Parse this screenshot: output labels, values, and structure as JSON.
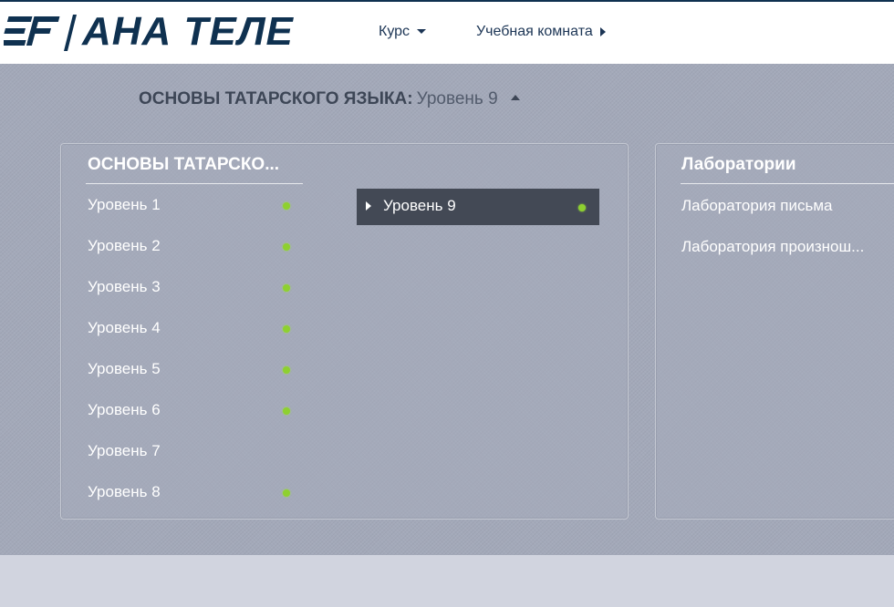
{
  "header": {
    "logo_text": "АНА ТЕЛЕ",
    "nav": {
      "course": "Курс",
      "classroom": "Учебная комната"
    }
  },
  "breadcrumb": {
    "course": "ОСНОВЫ ТАТАРСКОГО ЯЗЫКА:",
    "level": "Уровень 9"
  },
  "course_panel": {
    "title": "ОСНОВЫ ТАТАРСКО...",
    "levels": [
      {
        "label": "Уровень 1",
        "completed": true
      },
      {
        "label": "Уровень 2",
        "completed": true
      },
      {
        "label": "Уровень 3",
        "completed": true
      },
      {
        "label": "Уровень 4",
        "completed": true
      },
      {
        "label": "Уровень 5",
        "completed": true
      },
      {
        "label": "Уровень 6",
        "completed": true
      },
      {
        "label": "Уровень 7",
        "completed": false
      },
      {
        "label": "Уровень 8",
        "completed": true
      }
    ],
    "selected": {
      "label": "Уровень 9",
      "completed": true
    }
  },
  "labs_panel": {
    "title": "Лаборатории",
    "items": [
      {
        "label": "Лаборатория письма"
      },
      {
        "label": "Лаборатория произнош..."
      }
    ]
  },
  "colors": {
    "brand": "#0f3150",
    "completed_dot": "#8ed030",
    "selected_bg": "#434955"
  }
}
